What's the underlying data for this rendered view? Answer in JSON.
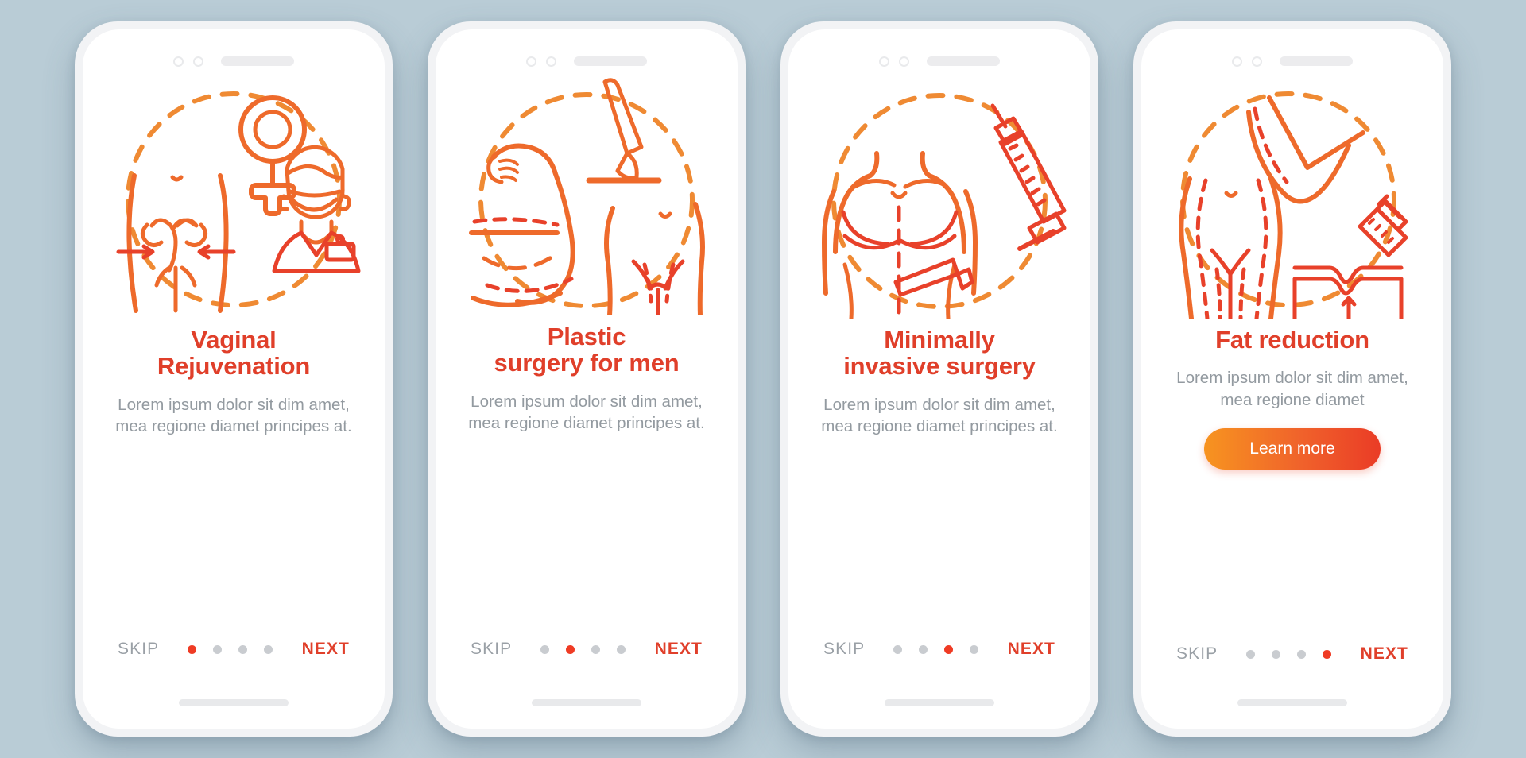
{
  "theme": {
    "background_color": "#b9ccd6",
    "card_color": "#ffffff",
    "accent_color": "#e03f2a",
    "illustration_color": "#ee6a2b",
    "illustration_color_dark": "#e8412a",
    "muted_text_color": "#939aa0",
    "dot_inactive_color": "#c9ccd0",
    "dot_active_color": "#ef3b24",
    "button_gradient_from": "#f79420",
    "button_gradient_to": "#ea3c26"
  },
  "screens": [
    {
      "id": "vaginal-rejuvenation",
      "title": "Vaginal\nRejuvenation",
      "description": "Lorem ipsum dolor sit dim amet, mea regione diamet principes at.",
      "illustration": "female-symbol-uterus-doctor-icon",
      "skip_label": "SKIP",
      "next_label": "NEXT",
      "dots_total": 4,
      "active_dot": 1,
      "has_learn_more": false,
      "learn_more_label": ""
    },
    {
      "id": "plastic-surgery-for-men",
      "title": "Plastic\nsurgery for men",
      "description": "Lorem ipsum dolor sit dim amet, mea regione diamet principes at.",
      "illustration": "flexing-arm-scalpel-torso-icon",
      "skip_label": "SKIP",
      "next_label": "NEXT",
      "dots_total": 4,
      "active_dot": 2,
      "has_learn_more": false,
      "learn_more_label": ""
    },
    {
      "id": "minimally-invasive-surgery",
      "title": "Minimally\ninvasive surgery",
      "description": "Lorem ipsum dolor sit dim amet, mea regione diamet principes at.",
      "illustration": "male-torso-syringe-scalpel-icon",
      "skip_label": "SKIP",
      "next_label": "NEXT",
      "dots_total": 4,
      "active_dot": 3,
      "has_learn_more": false,
      "learn_more_label": ""
    },
    {
      "id": "fat-reduction",
      "title": "Fat reduction",
      "description": "Lorem ipsum dolor sit dim amet, mea regione diamet",
      "illustration": "body-contour-syringe-skin-icon",
      "skip_label": "SKIP",
      "next_label": "NEXT",
      "dots_total": 4,
      "active_dot": 4,
      "has_learn_more": true,
      "learn_more_label": "Learn more"
    }
  ]
}
